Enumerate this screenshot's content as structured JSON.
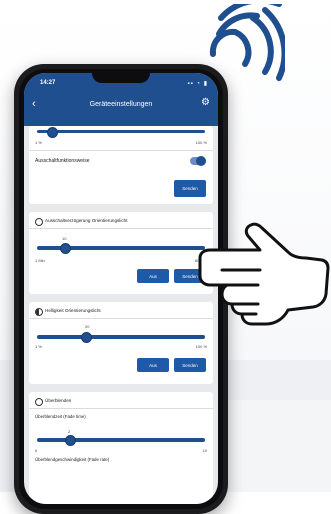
{
  "status": {
    "time": "14:27",
    "icons": "▪▪ ◔ ▮"
  },
  "app": {
    "title": "Geräteeinstellungen"
  },
  "card1": {
    "min_label": "1 %",
    "max_label": "100 %",
    "toggle_label": "Ausschaltfunktionsweise",
    "toggle_on": true,
    "send_label": "Senden"
  },
  "card2": {
    "heading": "Ausschaltverzögerung Orientierungslicht",
    "value_label": "10",
    "min_label": "1 Min",
    "max_label": "60 Min",
    "value_fraction": 0.17,
    "button_aus": "Aus",
    "button_send": "Senden"
  },
  "card3": {
    "heading": "Helligkeit Orientierungslicht",
    "value_label": "20",
    "min_label": "1 %",
    "max_label": "100 %",
    "value_fraction": 0.19,
    "button_aus": "Aus",
    "button_send": "Senden"
  },
  "card4": {
    "heading": "Überblenden",
    "sub1": "Überblendzeit (Fade time)",
    "value_label": "2",
    "min_label": "0",
    "max_label": "10",
    "value_fraction": 0.2,
    "sub2": "Überblendgeschwindigkeit (Fade rate)"
  },
  "colors": {
    "primary": "#1f4f8f",
    "button": "#1f5aa8",
    "screen_bg": "#e7e9ed"
  }
}
